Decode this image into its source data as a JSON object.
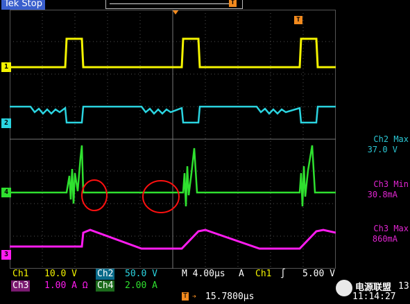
{
  "status": "Tek Stop",
  "trigger_marker": "T",
  "markers": {
    "ch1": "1",
    "ch2": "2",
    "ch3": "3",
    "ch4": "4"
  },
  "colors": {
    "ch1": "#f4f400",
    "ch2": "#2bd4e0",
    "ch3": "#ff1cf0",
    "ch4": "#2fe02f",
    "grid": "#555555",
    "trigger": "#f28a1e",
    "annotation": "#ff1010"
  },
  "measurements": [
    {
      "label": "Ch2 Max",
      "value": "37.0 V",
      "color": "#2bc7d4"
    },
    {
      "label": "Ch3 Min",
      "value": "30.8mA",
      "color": "#e025d0"
    },
    {
      "label": "Ch3 Max",
      "value": "860mA",
      "color": "#e025d0"
    }
  ],
  "bottom": {
    "ch1_label": "Ch1",
    "ch1_scale": "10.0 V",
    "ch2_label": "Ch2",
    "ch2_scale": "50.0 V",
    "timebase": "M 4.00µs",
    "trig_mode": "A",
    "trig_src": "Ch1",
    "trig_slope": "∫",
    "trig_level": "5.00 V",
    "ch3_label": "Ch3",
    "ch3_scale": "1.00 A Ω",
    "ch4_label": "Ch4",
    "ch4_scale": "2.00 A",
    "trig_pos_marker": "T",
    "trig_pos": "15.7800µs",
    "date_frag": "13",
    "time": "11:14:27"
  },
  "watermark": "电源联盟"
}
